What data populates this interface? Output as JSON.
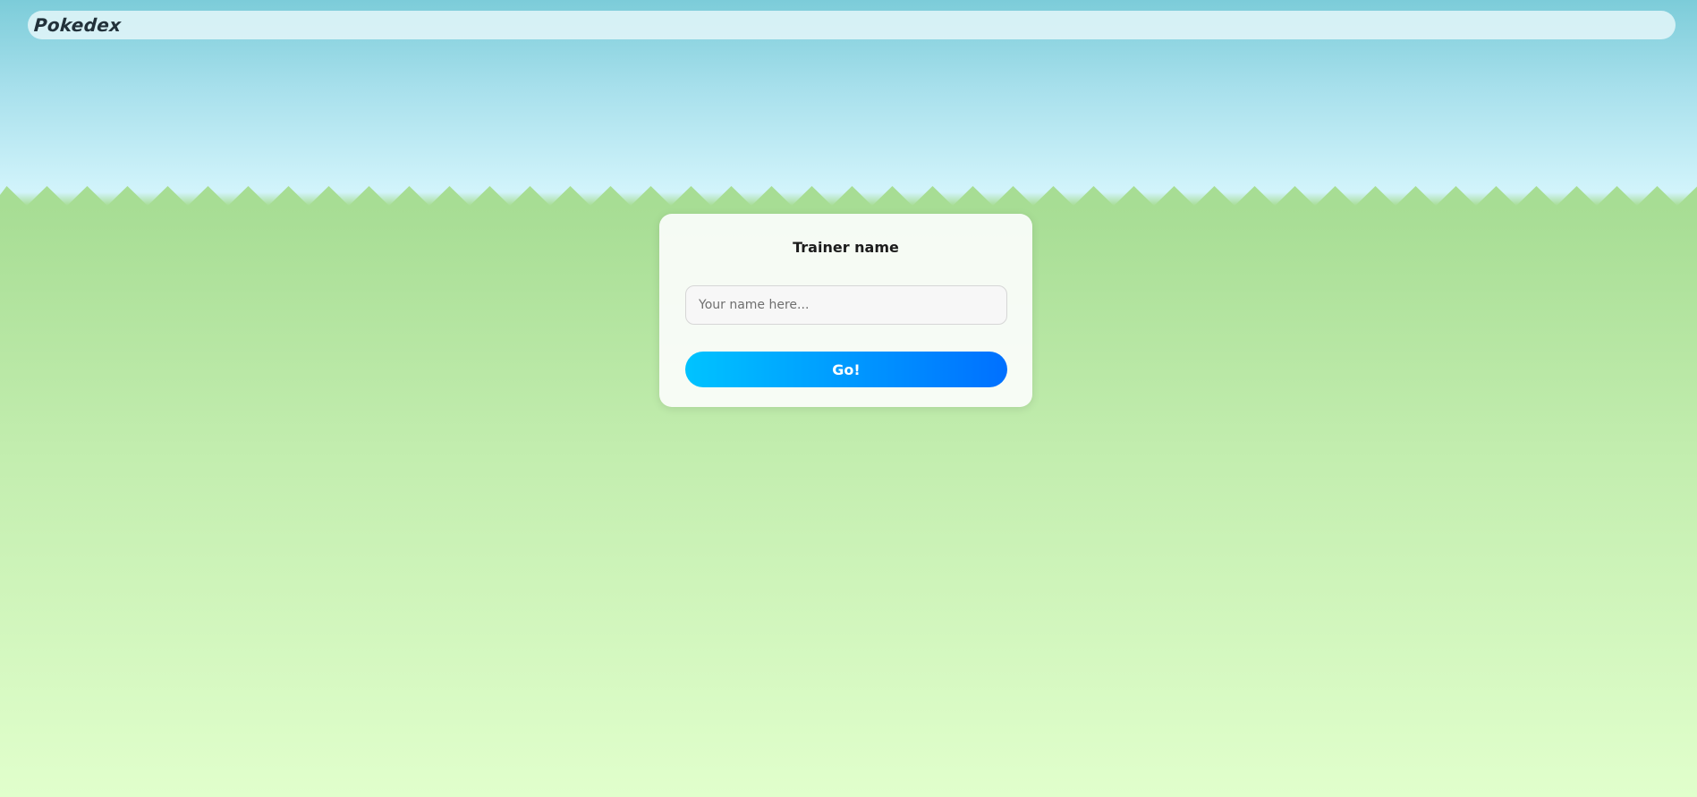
{
  "header": {
    "brand": "Pokedex"
  },
  "login_card": {
    "title": "Trainer name",
    "name_input": {
      "value": "",
      "placeholder": "Your name here..."
    },
    "submit_label": "Go!"
  },
  "colors": {
    "sky_top": "#7cccd9",
    "sky_bottom": "#d2f4fb",
    "grass_top": "#a7dd94",
    "grass_bottom": "#e1ffcc",
    "button_gradient_start": "#00c3ff",
    "button_gradient_end": "#0070ff"
  }
}
